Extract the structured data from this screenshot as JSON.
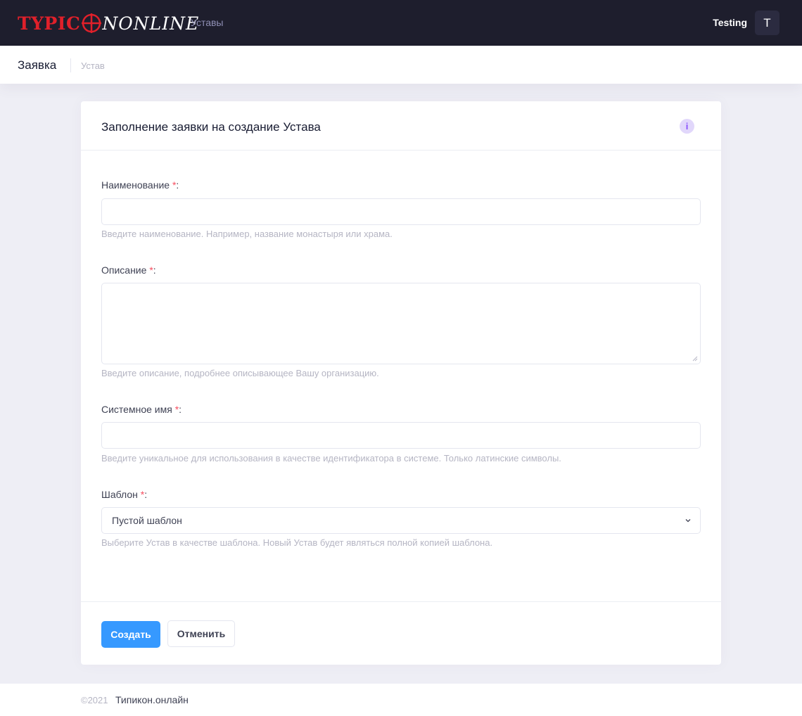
{
  "header": {
    "logo_part1": "TYPIC",
    "logo_part2": "NONLINE",
    "nav_link": "Уставы",
    "user_name": "Testing",
    "user_initial": "T",
    "accent_red": "#e0202a",
    "background": "#1e1e2d"
  },
  "subheader": {
    "title": "Заявка",
    "breadcrumb": "Устав"
  },
  "form": {
    "title": "Заполнение заявки на создание Устава",
    "info_icon": "info-icon",
    "required_mark": "*",
    "name": {
      "label": "Наименование",
      "value": "",
      "hint": "Введите наименование. Например, название монастыря или храма."
    },
    "description": {
      "label": "Описание",
      "value": "",
      "hint": "Введите описание, подробнее описывающее Вашу организацию."
    },
    "system_name": {
      "label": "Системное имя",
      "value": "",
      "hint": "Введите уникальное для использования в качестве идентификатора в системе. Только латинские символы."
    },
    "template": {
      "label": "Шаблон",
      "selected": "Пустой шаблон",
      "hint": "Выберите Устав в качестве шаблона. Новый Устав будет являться полной копией шаблона."
    },
    "create_button": "Создать",
    "cancel_button": "Отменить",
    "primary_color": "#3699ff"
  },
  "footer": {
    "copyright": "©2021",
    "site_link": "Типикон.онлайн"
  }
}
